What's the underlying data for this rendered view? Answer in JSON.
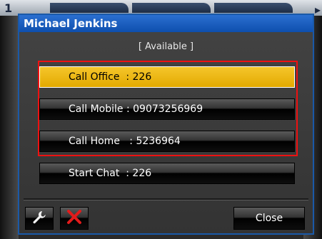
{
  "dialog": {
    "title": "Michael Jenkins",
    "status": "[ Available ]"
  },
  "buttons": {
    "call_office": "Call Office  : 226",
    "call_mobile": "Call Mobile : 09073256969",
    "call_home": "Call Home   : 5236964",
    "start_chat": "Start Chat  : 226",
    "close": "Close"
  },
  "icons": {
    "settings": "wrench-icon",
    "delete": "x-icon"
  },
  "colors": {
    "titlebar": "#1a59a8",
    "selected": "#e8b000",
    "highlight_border": "#e11111",
    "delete_icon": "#e21b1b"
  }
}
